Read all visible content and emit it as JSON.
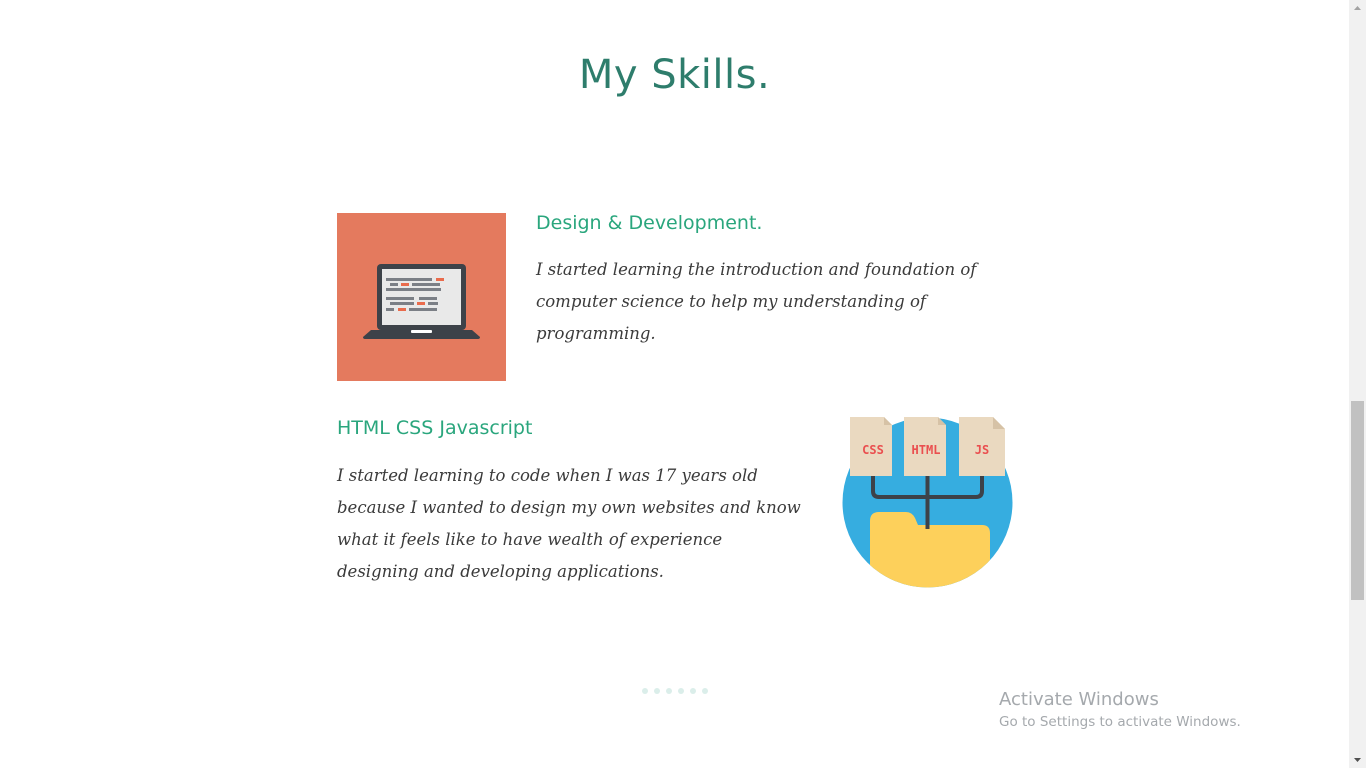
{
  "section": {
    "title": "My Skills."
  },
  "skills": [
    {
      "heading": "Design & Development.",
      "text": "I started learning the introduction and foundation of computer science to help my understanding of programming.",
      "icon": "laptop-icon"
    },
    {
      "heading": "HTML CSS Javascript",
      "text": "I started learning to code when I was 17 years old because I wanted to design my own websites and know what it feels like to have wealth of experience designing and developing applications.",
      "icon": "web-files-icon",
      "file_labels": [
        "CSS",
        "HTML",
        "JS"
      ]
    }
  ],
  "loader": {
    "dot_count": 6
  },
  "watermark": {
    "title": "Activate Windows",
    "subtitle": "Go to Settings to activate Windows."
  },
  "colors": {
    "title": "#2e7d6c",
    "heading": "#2aa67d",
    "laptop_tile": "#e47a5e",
    "icon_circle": "#36ade0",
    "folder": "#fdd05b",
    "file": "#ead9c0",
    "file_text": "#ea4f4f"
  },
  "scrollbar": {
    "position": 0.52
  }
}
